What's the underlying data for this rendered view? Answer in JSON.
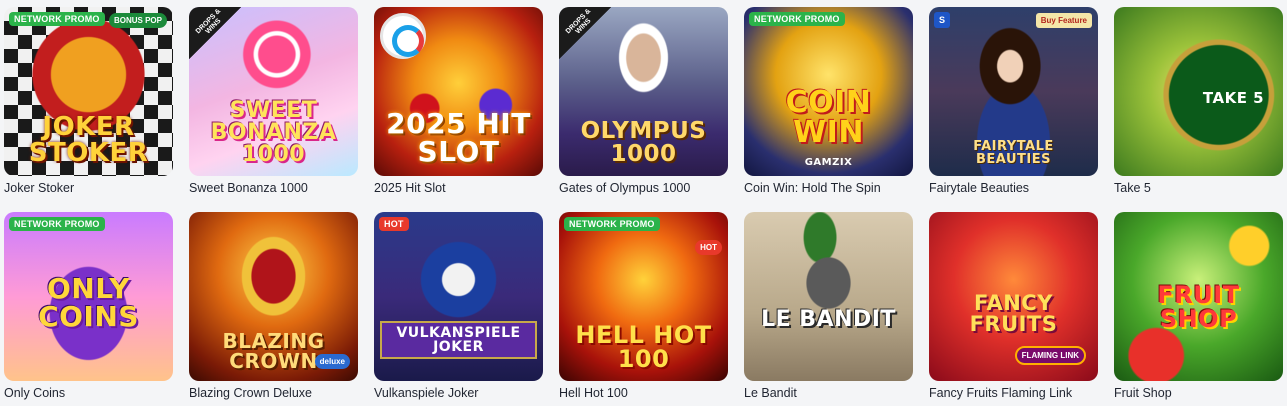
{
  "games": [
    {
      "name": "Joker Stoker",
      "art": "JOKER STOKER",
      "badge": "NETWORK PROMO",
      "extra": "BONUS POP"
    },
    {
      "name": "Sweet Bonanza 1000",
      "art": "SWEET BONANZA 1000",
      "badge": "",
      "extra": "DROPS & WINS"
    },
    {
      "name": "2025 Hit Slot",
      "art": "2025 HIT SLOT",
      "badge": "",
      "extra": ""
    },
    {
      "name": "Gates of Olympus 1000",
      "art": "OLYMPUS 1000",
      "badge": "",
      "extra": "DROPS & WINS"
    },
    {
      "name": "Coin Win: Hold The Spin",
      "art": "COIN WIN",
      "badge": "NETWORK PROMO",
      "extra": "GAMZIX"
    },
    {
      "name": "Fairytale Beauties",
      "art": "FAIRYTALE BEAUTIES",
      "badge": "",
      "extra": "Buy Feature"
    },
    {
      "name": "Take 5",
      "art": "TAKE 5",
      "badge": "",
      "extra": ""
    },
    {
      "name": "Only Coins",
      "art": "ONLY COINS",
      "badge": "NETWORK PROMO",
      "extra": ""
    },
    {
      "name": "Blazing Crown Deluxe",
      "art": "BLAZING CROWN",
      "badge": "",
      "extra": "deluxe"
    },
    {
      "name": "Vulkanspiele Joker",
      "art": "VULKANSPIELE JOKER",
      "badge": "HOT",
      "extra": ""
    },
    {
      "name": "Hell Hot 100",
      "art": "HELL HOT 100",
      "badge": "NETWORK PROMO",
      "extra": "HOT"
    },
    {
      "name": "Le Bandit",
      "art": "LE BANDIT",
      "badge": "",
      "extra": ""
    },
    {
      "name": "Fancy Fruits Flaming Link",
      "art": "FANCY FRUITS",
      "badge": "",
      "extra": "FLAMING LINK"
    },
    {
      "name": "Fruit Shop",
      "art": "FRUIT SHOP",
      "badge": "",
      "extra": ""
    }
  ],
  "colors": {
    "promo": "#2bb34a",
    "hot": "#e8392b",
    "caption": "#1f2430",
    "page_bg": "#f4f5f7"
  }
}
